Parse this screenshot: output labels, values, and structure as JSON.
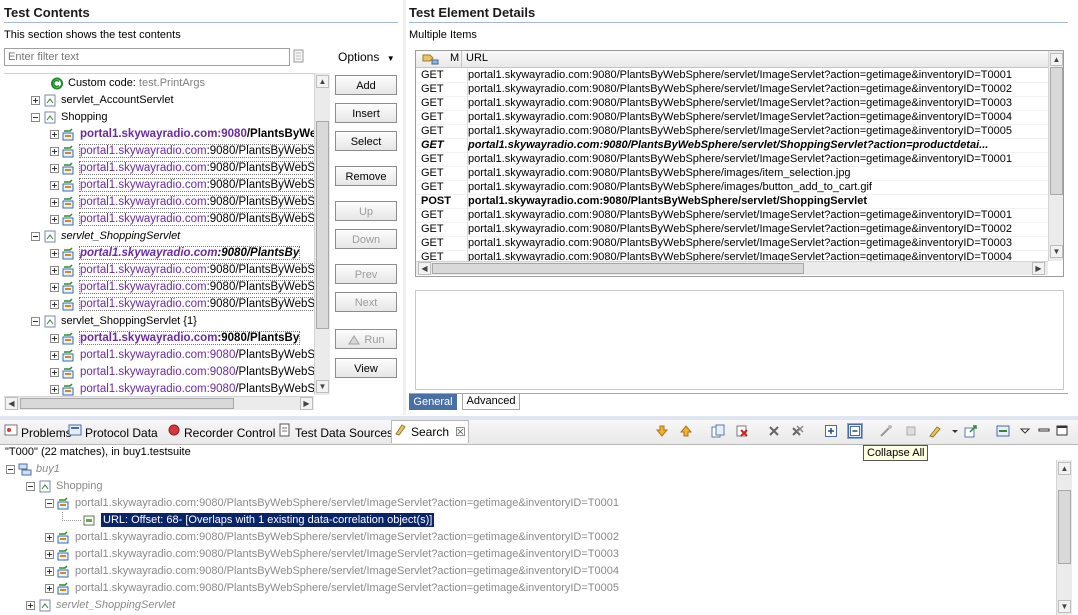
{
  "left_panel": {
    "title": "Test Contents",
    "subtitle": "This section shows the test contents",
    "filter_placeholder": "Enter filter text",
    "options_label": "Options",
    "tree": [
      {
        "level": 2,
        "expand": "none",
        "icon": "custom-code",
        "text": "Custom code: ",
        "suffix": "test.PrintArgs",
        "style": "custom"
      },
      {
        "level": 1,
        "expand": "plus",
        "icon": "page",
        "text": "servlet_AccountServlet",
        "style": "normal"
      },
      {
        "level": 1,
        "expand": "minus",
        "icon": "page",
        "text": "Shopping",
        "style": "normal"
      },
      {
        "level": 2,
        "expand": "plus",
        "icon": "request",
        "host": "portal1.skywayradio.com",
        "port": ":9080",
        "path": "/PlantsByWe",
        "style": "bold"
      },
      {
        "level": 2,
        "expand": "plus",
        "icon": "request",
        "host": "portal1.skywayradio.com",
        "port": ":9080",
        "path": "/PlantsByWebSph",
        "style": "dotted"
      },
      {
        "level": 2,
        "expand": "plus",
        "icon": "request",
        "host": "portal1.skywayradio.com",
        "port": ":9080",
        "path": "/PlantsByWebSph",
        "style": "dotted"
      },
      {
        "level": 2,
        "expand": "plus",
        "icon": "request",
        "host": "portal1.skywayradio.com",
        "port": ":9080",
        "path": "/PlantsByWebSph",
        "style": "dotted"
      },
      {
        "level": 2,
        "expand": "plus",
        "icon": "request",
        "host": "portal1.skywayradio.com",
        "port": ":9080",
        "path": "/PlantsByWebSph",
        "style": "dotted"
      },
      {
        "level": 2,
        "expand": "plus",
        "icon": "request",
        "host": "portal1.skywayradio.com",
        "port": ":9080",
        "path": "/PlantsByWebSph",
        "style": "dotted"
      },
      {
        "level": 1,
        "expand": "minus",
        "icon": "page",
        "text": "servlet_ShoppingServlet",
        "style": "italic"
      },
      {
        "level": 2,
        "expand": "plus",
        "icon": "request",
        "host": "portal1.skywayradio.com",
        "port": ":9080",
        "path": "/PlantsBy",
        "style": "bolditalic-dotted"
      },
      {
        "level": 2,
        "expand": "plus",
        "icon": "request",
        "host": "portal1.skywayradio.com",
        "port": ":9080",
        "path": "/PlantsByWebSph",
        "style": "dotted"
      },
      {
        "level": 2,
        "expand": "plus",
        "icon": "request",
        "host": "portal1.skywayradio.com",
        "port": ":9080",
        "path": "/PlantsByWebSph",
        "style": "dotted"
      },
      {
        "level": 2,
        "expand": "plus",
        "icon": "request",
        "host": "portal1.skywayradio.com",
        "port": ":9080",
        "path": "/PlantsByWebSph",
        "style": "dotted"
      },
      {
        "level": 1,
        "expand": "minus",
        "icon": "page",
        "text": "servlet_ShoppingServlet {1}",
        "style": "normal"
      },
      {
        "level": 2,
        "expand": "plus",
        "icon": "request",
        "host": "portal1.skywayradio.com",
        "port": ":9080",
        "path": "/PlantsBy",
        "style": "bold-dotted"
      },
      {
        "level": 2,
        "expand": "plus",
        "icon": "request",
        "host": "portal1.skywayradio.com",
        "port": ":9080",
        "path": "/PlantsByWebSph",
        "style": "purple"
      },
      {
        "level": 2,
        "expand": "plus",
        "icon": "request",
        "host": "portal1.skywayradio.com",
        "port": ":9080",
        "path": "/PlantsByWebSph",
        "style": "purple"
      },
      {
        "level": 2,
        "expand": "plus",
        "icon": "request",
        "host": "portal1.skywayradio.com",
        "port": ":9080",
        "path": "/PlantsByWebSph",
        "style": "purple"
      }
    ],
    "buttons": [
      {
        "label": "Add",
        "enabled": true,
        "underline": "A"
      },
      {
        "label": "Insert",
        "enabled": true
      },
      {
        "label": "Select",
        "enabled": true
      },
      {
        "label": "Remove",
        "enabled": true
      },
      {
        "label": "Up",
        "enabled": false
      },
      {
        "label": "Down",
        "enabled": false
      },
      {
        "label": "Prev",
        "enabled": false
      },
      {
        "label": "Next",
        "enabled": false
      },
      {
        "label": "Run",
        "enabled": false
      },
      {
        "label": "View",
        "enabled": true
      }
    ]
  },
  "right_panel": {
    "title": "Test Element Details",
    "subtitle": "Multiple Items",
    "columns": [
      "M",
      "URL"
    ],
    "rows": [
      {
        "method": "GET",
        "url": "portal1.skywayradio.com:9080/PlantsByWebSphere/servlet/ImageServlet?action=getimage&inventoryID=T0001",
        "style": "normal"
      },
      {
        "method": "GET",
        "url": "portal1.skywayradio.com:9080/PlantsByWebSphere/servlet/ImageServlet?action=getimage&inventoryID=T0002",
        "style": "normal"
      },
      {
        "method": "GET",
        "url": "portal1.skywayradio.com:9080/PlantsByWebSphere/servlet/ImageServlet?action=getimage&inventoryID=T0003",
        "style": "normal"
      },
      {
        "method": "GET",
        "url": "portal1.skywayradio.com:9080/PlantsByWebSphere/servlet/ImageServlet?action=getimage&inventoryID=T0004",
        "style": "normal"
      },
      {
        "method": "GET",
        "url": "portal1.skywayradio.com:9080/PlantsByWebSphere/servlet/ImageServlet?action=getimage&inventoryID=T0005",
        "style": "normal"
      },
      {
        "method": "GET",
        "url": "portal1.skywayradio.com:9080/PlantsByWebSphere/servlet/ShoppingServlet?action=productdetai...",
        "style": "bolditalic"
      },
      {
        "method": "GET",
        "url": "portal1.skywayradio.com:9080/PlantsByWebSphere/servlet/ImageServlet?action=getimage&inventoryID=T0001",
        "style": "normal"
      },
      {
        "method": "GET",
        "url": "portal1.skywayradio.com:9080/PlantsByWebSphere/images/item_selection.jpg",
        "style": "normal"
      },
      {
        "method": "GET",
        "url": "portal1.skywayradio.com:9080/PlantsByWebSphere/images/button_add_to_cart.gif",
        "style": "normal"
      },
      {
        "method": "POST",
        "url": "portal1.skywayradio.com:9080/PlantsByWebSphere/servlet/ShoppingServlet",
        "style": "bold"
      },
      {
        "method": "GET",
        "url": "portal1.skywayradio.com:9080/PlantsByWebSphere/servlet/ImageServlet?action=getimage&inventoryID=T0001",
        "style": "normal"
      },
      {
        "method": "GET",
        "url": "portal1.skywayradio.com:9080/PlantsByWebSphere/servlet/ImageServlet?action=getimage&inventoryID=T0002",
        "style": "normal"
      },
      {
        "method": "GET",
        "url": "portal1.skywayradio.com:9080/PlantsByWebSphere/servlet/ImageServlet?action=getimage&inventoryID=T0003",
        "style": "normal"
      },
      {
        "method": "GET",
        "url": "portal1.skywayradio.com:9080/PlantsByWebSphere/servlet/ImageServlet?action=getimage&inventoryID=T0004",
        "style": "normal"
      }
    ],
    "tabs": [
      {
        "label": "General",
        "active": true
      },
      {
        "label": "Advanced",
        "active": false
      }
    ]
  },
  "bottom_tabs": [
    {
      "label": "Problems",
      "icon": "problems-icon",
      "active": false
    },
    {
      "label": "Protocol Data",
      "icon": "protocol-data-icon",
      "active": false
    },
    {
      "label": "Recorder Control",
      "icon": "recorder-control-icon",
      "active": false
    },
    {
      "label": "Test Data Sources",
      "icon": "test-data-sources-icon",
      "active": false
    },
    {
      "label": "Search",
      "icon": "search-icon",
      "active": true,
      "closable": true
    }
  ],
  "tooltip": "Collapse All",
  "search": {
    "summary": "\"T000\" (22 matches), in buy1.testsuite",
    "results": [
      {
        "level": 0,
        "expand": "minus",
        "icon": "testsuite",
        "text": "buy1",
        "style": "italic-grey"
      },
      {
        "level": 1,
        "expand": "minus",
        "icon": "page",
        "text": "Shopping",
        "style": "grey"
      },
      {
        "level": 2,
        "expand": "minus",
        "icon": "request",
        "text": "portal1.skywayradio.com:9080/PlantsByWebSphere/servlet/ImageServlet?action=getimage&inventoryID=T0001",
        "style": "grey"
      },
      {
        "level": 3,
        "expand": "none",
        "icon": "match",
        "text": "URL: Offset: 68- [Overlaps with 1 existing data-correlation object(s)]",
        "style": "selected"
      },
      {
        "level": 2,
        "expand": "plus",
        "icon": "request",
        "text": "portal1.skywayradio.com:9080/PlantsByWebSphere/servlet/ImageServlet?action=getimage&inventoryID=T0002",
        "style": "grey"
      },
      {
        "level": 2,
        "expand": "plus",
        "icon": "request",
        "text": "portal1.skywayradio.com:9080/PlantsByWebSphere/servlet/ImageServlet?action=getimage&inventoryID=T0003",
        "style": "grey"
      },
      {
        "level": 2,
        "expand": "plus",
        "icon": "request",
        "text": "portal1.skywayradio.com:9080/PlantsByWebSphere/servlet/ImageServlet?action=getimage&inventoryID=T0004",
        "style": "grey"
      },
      {
        "level": 2,
        "expand": "plus",
        "icon": "request",
        "text": "portal1.skywayradio.com:9080/PlantsByWebSphere/servlet/ImageServlet?action=getimage&inventoryID=T0005",
        "style": "grey"
      },
      {
        "level": 1,
        "expand": "plus",
        "icon": "page",
        "text": "servlet_ShoppingServlet",
        "style": "italic-grey"
      }
    ]
  }
}
